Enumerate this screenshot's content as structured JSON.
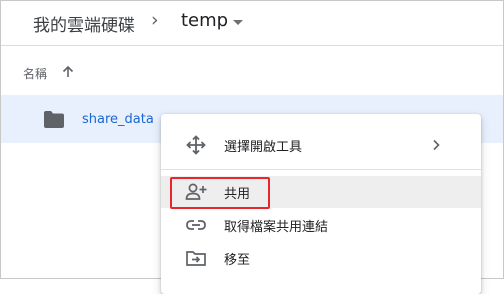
{
  "breadcrumb": {
    "root_label": "我的雲端硬碟",
    "separator": "›",
    "current_label": "temp"
  },
  "list": {
    "column_name_label": "名稱",
    "sort_direction": "ascending",
    "rows": [
      {
        "name": "share_data",
        "type": "folder",
        "selected": true
      }
    ]
  },
  "context_menu": {
    "items": [
      {
        "label": "選擇開啟工具",
        "icon": "open-with-icon",
        "has_submenu": true
      },
      {
        "label": "共用",
        "icon": "person-add-icon",
        "highlighted": true
      },
      {
        "label": "取得檔案共用連結",
        "icon": "link-icon"
      },
      {
        "label": "移至",
        "icon": "move-to-folder-icon"
      }
    ]
  },
  "colors": {
    "selected_row_bg": "#e8f0fe",
    "link_text": "#1967d2",
    "highlight_border": "#e8262b",
    "icon_gray": "#5f6368"
  }
}
